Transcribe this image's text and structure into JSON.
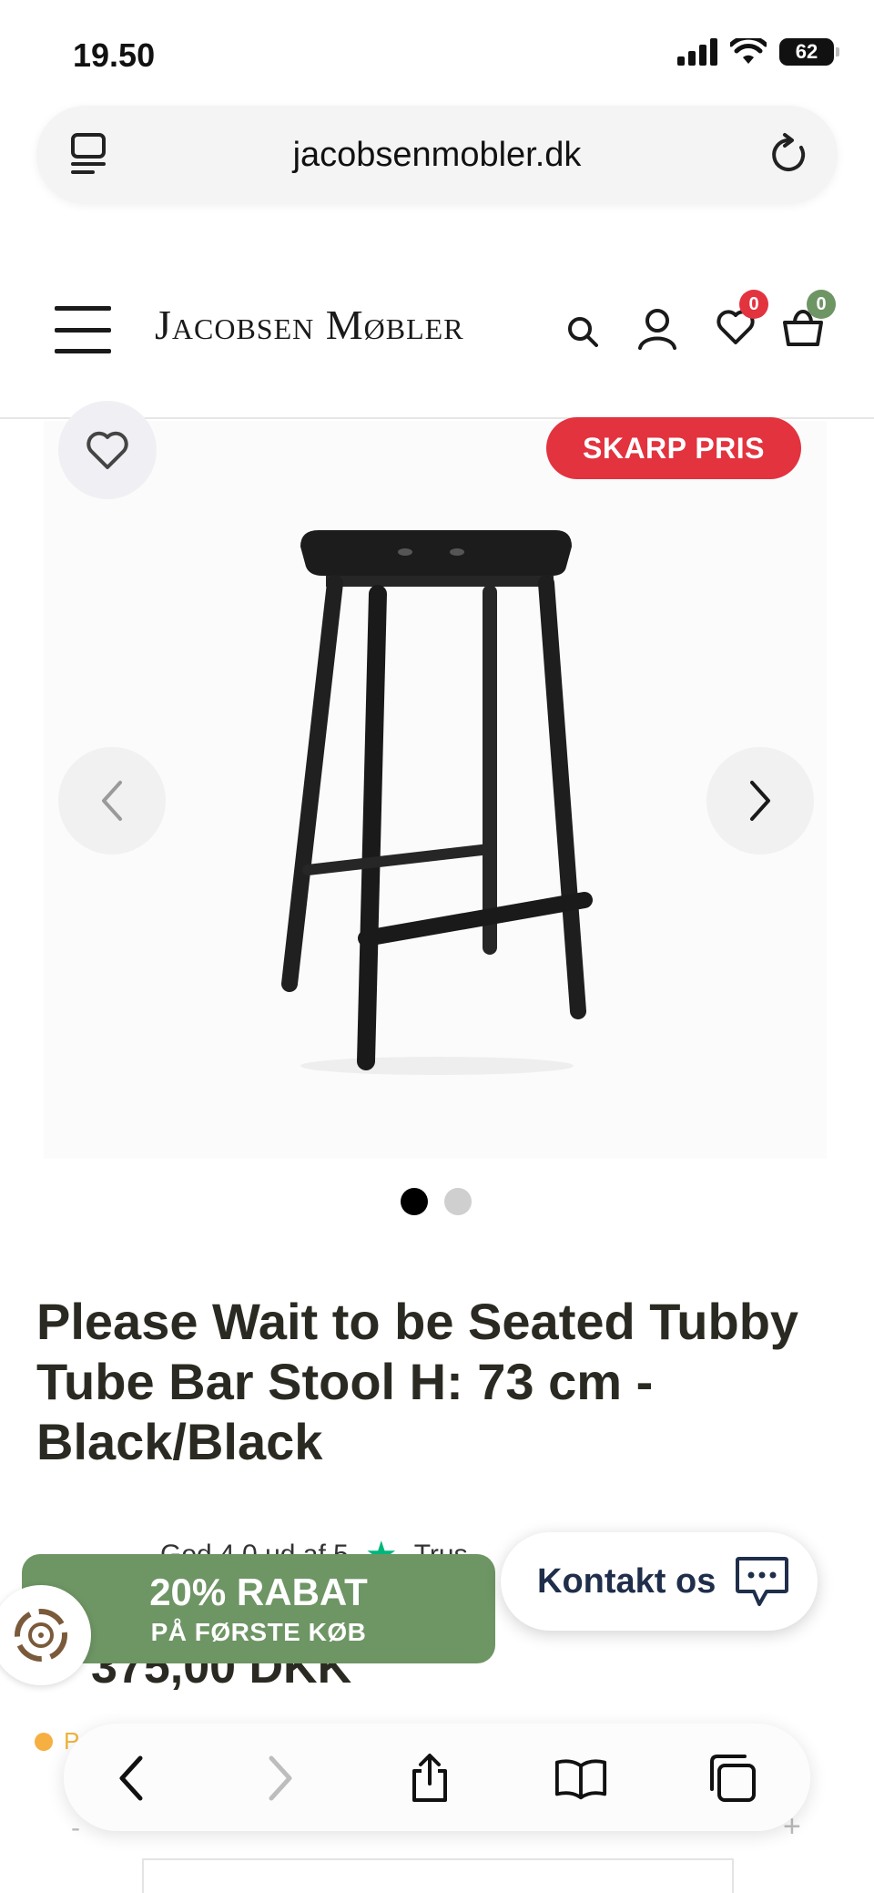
{
  "status_bar": {
    "time": "19.50",
    "battery": "62"
  },
  "browser": {
    "url": "jacobsenmobler.dk"
  },
  "header": {
    "logo": "Jacobsen Møbler",
    "wishlist_count": "0",
    "cart_count": "0",
    "colors": {
      "wishlist_badge": "#e2333f",
      "cart_badge": "#6e9564"
    }
  },
  "product": {
    "price_tag": "SKARP PRIS",
    "title": "Please Wait to be Seated Tubby Tube Bar Stool H: 73 cm - Black/Black",
    "gallery": {
      "total_images": 2,
      "active_index": 0
    },
    "review_text": "God   4,0 ud af 5",
    "review_brand": "Trus",
    "price": "375,00 DKK",
    "stock_text": "P"
  },
  "discount_banner": {
    "title": "20% RABAT",
    "subtitle": "PÅ FØRSTE KØB"
  },
  "contact": {
    "label": "Kontakt os"
  },
  "toolbar": {
    "icons": [
      "back-icon",
      "forward-icon",
      "share-icon",
      "bookmarks-icon",
      "tabs-icon"
    ]
  },
  "quantity": {
    "minus": "-",
    "plus": "+"
  }
}
